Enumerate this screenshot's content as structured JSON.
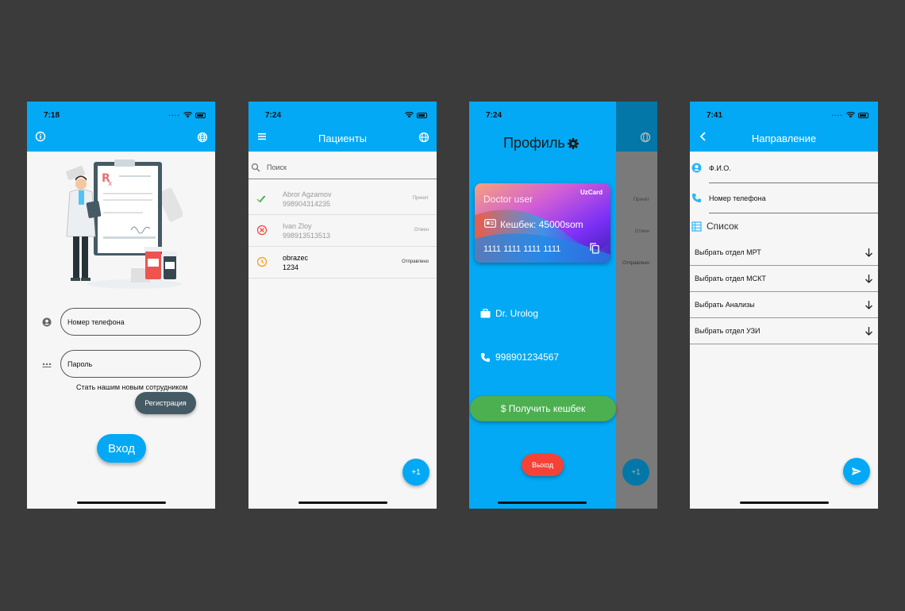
{
  "login": {
    "time": "7:18",
    "phone_placeholder": "Номер телефона",
    "password_placeholder": "Пароль",
    "join_text": "Стать нашим новым сотрудником",
    "register_label": "Регистрация",
    "login_label": "Вход"
  },
  "patients": {
    "time": "7:24",
    "title": "Пациенты",
    "search_placeholder": "Поиск",
    "rows": [
      {
        "name": "Abror Agzamov",
        "phone": "998904314235",
        "status": "Принят",
        "icon": "double-check-icon",
        "color": "#4caf50"
      },
      {
        "name": "Ivan Zloy",
        "phone": "998913513513",
        "status": "Отмен",
        "icon": "cancel-circle-icon",
        "color": "#f44336"
      },
      {
        "name": "obrazec",
        "phone": "1234",
        "status": "Отправлено",
        "icon": "clock-icon",
        "color": "#ff9800"
      }
    ],
    "fab_label": "+1"
  },
  "profile": {
    "time": "7:24",
    "title": "Профиль",
    "card_owner": "Doctor user",
    "card_brand": "UzCard",
    "cashback": "Кешбек: 45000som",
    "card_number": "1111 1111 1111 1111",
    "specialty": "Dr. Urolog",
    "phone": "998901234567",
    "cashback_button": "$ Получить кешбек",
    "exit_label": "Выход",
    "bg_status_labels": [
      "Принят",
      "Отмен",
      "Отправлено"
    ],
    "bg_fab_label": "+1"
  },
  "direction": {
    "time": "7:41",
    "title": "Направление",
    "fio_label": "Ф.И.О.",
    "phone_label": "Номер телефона",
    "list_label": "Список",
    "options": [
      "Выбрать отдел МРТ",
      "Выбрать отдел МСКТ",
      "Выбрать Анализы",
      "Выбрать отдел УЗИ"
    ]
  },
  "colors": {
    "primary": "#03a9f4",
    "success": "#4caf50",
    "danger": "#f44336",
    "dark_button": "#455a64"
  }
}
